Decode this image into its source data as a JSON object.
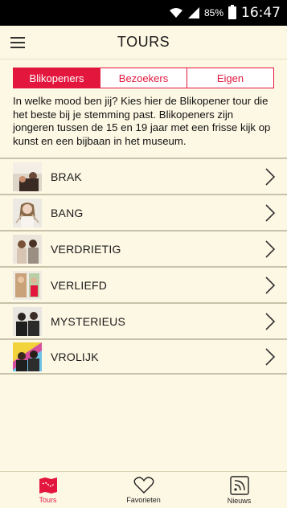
{
  "status": {
    "battery": "85%",
    "time": "16:47"
  },
  "header": {
    "title": "TOURS"
  },
  "tabs": [
    {
      "label": "Blikopeners",
      "active": true
    },
    {
      "label": "Bezoekers",
      "active": false
    },
    {
      "label": "Eigen",
      "active": false
    }
  ],
  "intro": "In welke mood ben jij? Kies hier de Blikopener tour die het beste bij je stemming past. Blikopeners zijn jongeren tussen de 15 en 19 jaar met een frisse kijk op kunst en een bijbaan in het museum.",
  "tours": [
    {
      "label": "BRAK"
    },
    {
      "label": "BANG"
    },
    {
      "label": "VERDRIETIG"
    },
    {
      "label": "VERLIEFD"
    },
    {
      "label": "MYSTERIEUS"
    },
    {
      "label": "VROLIJK"
    }
  ],
  "bottomnav": [
    {
      "label": "Tours",
      "icon": "map-icon",
      "active": true
    },
    {
      "label": "Favorieten",
      "icon": "heart-icon",
      "active": false
    },
    {
      "label": "Nieuws",
      "icon": "rss-icon",
      "active": false
    }
  ],
  "colors": {
    "accent": "#e3173e",
    "background": "#fdf8e4"
  }
}
